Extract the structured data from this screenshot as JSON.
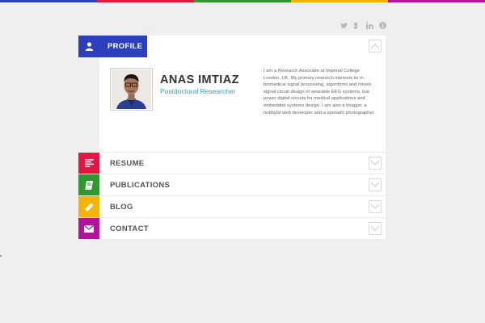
{
  "topbar_colors": [
    "#2c3fbd",
    "#e3163f",
    "#2e9a2d",
    "#f6b400",
    "#b3119e"
  ],
  "social": {
    "icons": [
      "twitter-icon",
      "google-plus-icon",
      "linkedin-icon",
      "info-icon"
    ],
    "glyphs": [
      "t",
      "g",
      "in",
      "i"
    ]
  },
  "profile": {
    "label": "PROFILE",
    "color": "#2c3fbd",
    "name": "ANAS IMTIAZ",
    "role": "Postdoctoral Researcher",
    "bio": "I am a Research Associate at Imperial College London, UK. My primary research interests lie in biomedical signal processing, algorithms and mixed-signal circuit design of wearable EEG systems, low power digital circuits for medical applications and embedded systems design. I am also a blogger, a hobbyist web developer and a sporadic photographer."
  },
  "sections": [
    {
      "label": "RESUME",
      "color": "#e3163f",
      "icon": "resume-icon"
    },
    {
      "label": "PUBLICATIONS",
      "color": "#2e9a2d",
      "icon": "book-icon"
    },
    {
      "label": "BLOG",
      "color": "#f6b400",
      "icon": "pencil-icon"
    },
    {
      "label": "CONTACT",
      "color": "#b3119e",
      "icon": "envelope-icon"
    }
  ]
}
